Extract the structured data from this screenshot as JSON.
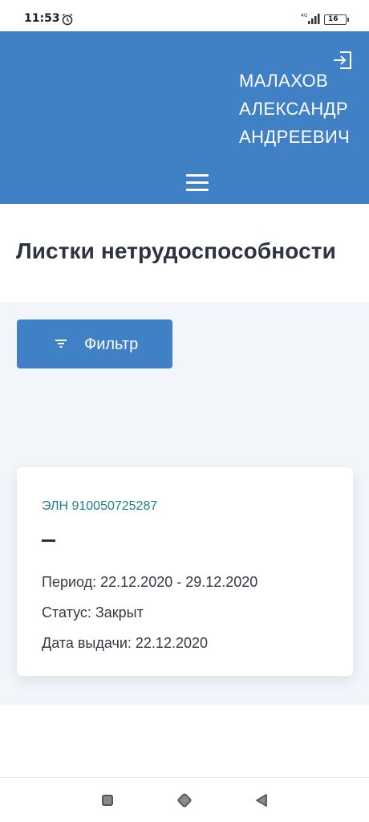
{
  "status_bar": {
    "time": "11:53",
    "network": "4G",
    "battery": "16"
  },
  "header": {
    "user_name_lines": [
      "МАЛАХОВ",
      "АЛЕКСАНДР",
      "АНДРЕЕВИЧ"
    ],
    "icons": {
      "logout": "logout-icon",
      "menu": "hamburger-menu-icon"
    }
  },
  "page": {
    "title": "Листки нетрудоспособности"
  },
  "filter": {
    "label": "Фильтр",
    "icon": "filter-icon"
  },
  "cards": [
    {
      "title": "ЭЛН 910050725287",
      "subtitle": "—",
      "period": "Период: 22.12.2020 - 29.12.2020",
      "status": "Статус: Закрыт",
      "issue_date": "Дата выдачи: 22.12.2020"
    }
  ],
  "colors": {
    "primary": "#3f81c4",
    "link": "#1e8086",
    "background": "#f2f5fa"
  }
}
